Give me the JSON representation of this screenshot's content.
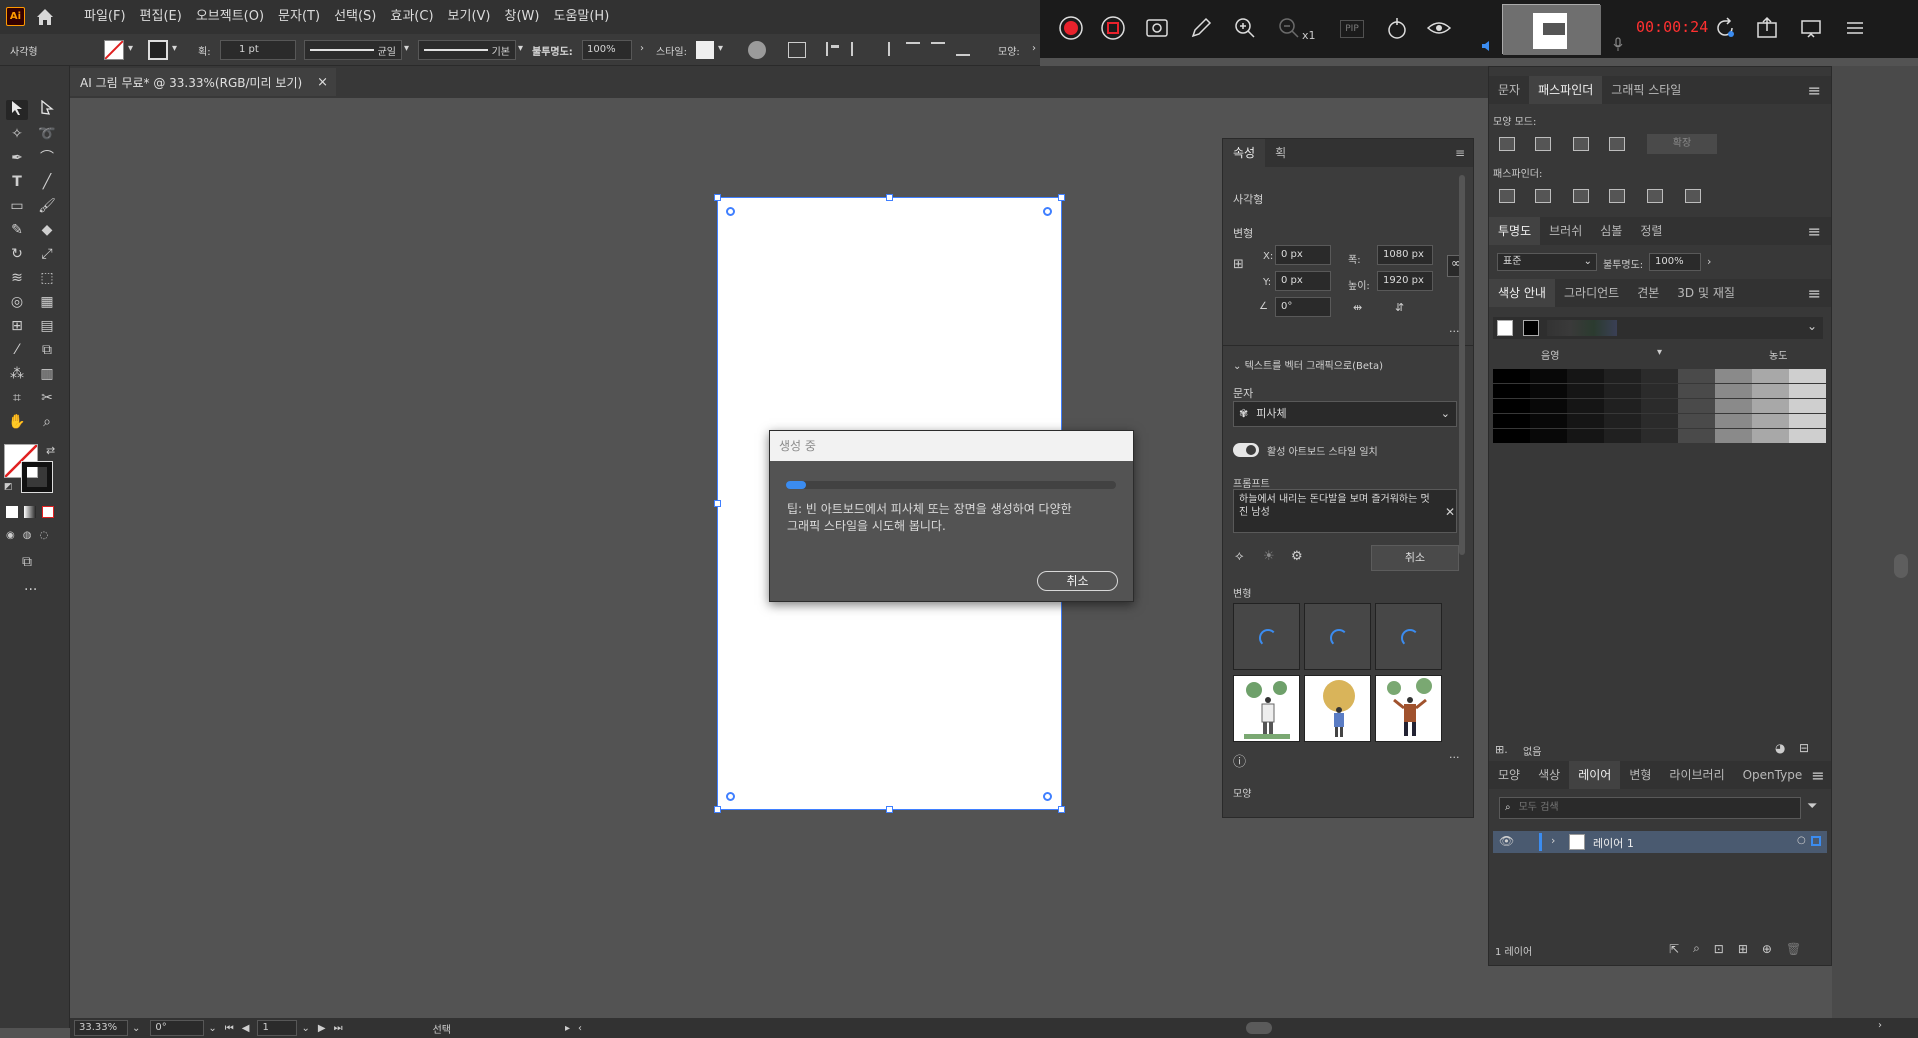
{
  "menubar": {
    "logo": "Ai",
    "items": [
      "파일(F)",
      "편집(E)",
      "오브젝트(O)",
      "문자(T)",
      "선택(S)",
      "효과(C)",
      "보기(V)",
      "창(W)",
      "도움말(H)"
    ]
  },
  "recorder": {
    "time": "00:00:24",
    "zoom_suffix": "x1",
    "pip": "PIP"
  },
  "control": {
    "object_type": "사각형",
    "stroke_label": "획:",
    "stroke_value": "1 pt",
    "profile": "균일",
    "brush": "기본",
    "opacity_label": "불투명도:",
    "opacity_value": "100%",
    "style_label": "스타일:",
    "shape_label": "모양:"
  },
  "document": {
    "tab_title": "AI 그림 무료* @ 33.33%(RGB/미리 보기)",
    "close": "×"
  },
  "dialog": {
    "title": "생성 중",
    "progress_fraction": 0.06,
    "tip_line1": "팁: 빈 아트보드에서 피사체 또는 장면을 생성하여 다양한",
    "tip_line2": "그래픽 스타일을 시도해 봅니다.",
    "cancel": "취소"
  },
  "properties": {
    "tabs": [
      "속성",
      "획"
    ],
    "object": "사각형",
    "transform_label": "변형",
    "x_label": "X:",
    "x_value": "0 px",
    "y_label": "Y:",
    "y_value": "0 px",
    "w_label": "폭:",
    "w_value": "1080 px",
    "h_label": "높이:",
    "h_value": "1920 px",
    "angle_value": "0°",
    "text_to_vector": "텍스트를 벡터 그래픽으로(Beta)",
    "type_label": "문자",
    "type_value": "피사체",
    "match_style": "활성 아트보드 스타일 일치",
    "prompt_label": "프롬프트",
    "prompt_value": "하늘에서 내리는 돈다발을 보며 즐거워하는 멋진 남성",
    "cancel": "취소",
    "variations_label": "변형",
    "appearance_label": "모양"
  },
  "dock": {
    "tabs_top": [
      "문자",
      "패스파인더",
      "그래픽 스타일"
    ],
    "shape_modes": "모양 모드:",
    "expand": "확장",
    "pathfinders": "패스파인더:",
    "tabs_transparency": [
      "투명도",
      "브러쉬",
      "심볼",
      "정렬"
    ],
    "blend_mode": "표준",
    "opacity_label": "불투명도:",
    "opacity_value": "100%",
    "tabs_color": [
      "색상 안내",
      "그라디언트",
      "견본",
      "3D 및 재질"
    ],
    "shade_label": "음영",
    "tint_label": "농도",
    "none_label": "없음",
    "tabs_layers": [
      "모양",
      "색상",
      "레이어",
      "변형",
      "라이브러리",
      "OpenType"
    ],
    "search_placeholder": "모두 검색",
    "layer_name": "레이어 1",
    "layer_count": "1 레이어"
  },
  "status": {
    "zoom": "33.33%",
    "rotation": "0°",
    "artboard": "1",
    "tool": "선택"
  },
  "colors": {
    "accent": "#3b8cf0",
    "selection": "#3f7fff",
    "timer": "#ff3030"
  }
}
